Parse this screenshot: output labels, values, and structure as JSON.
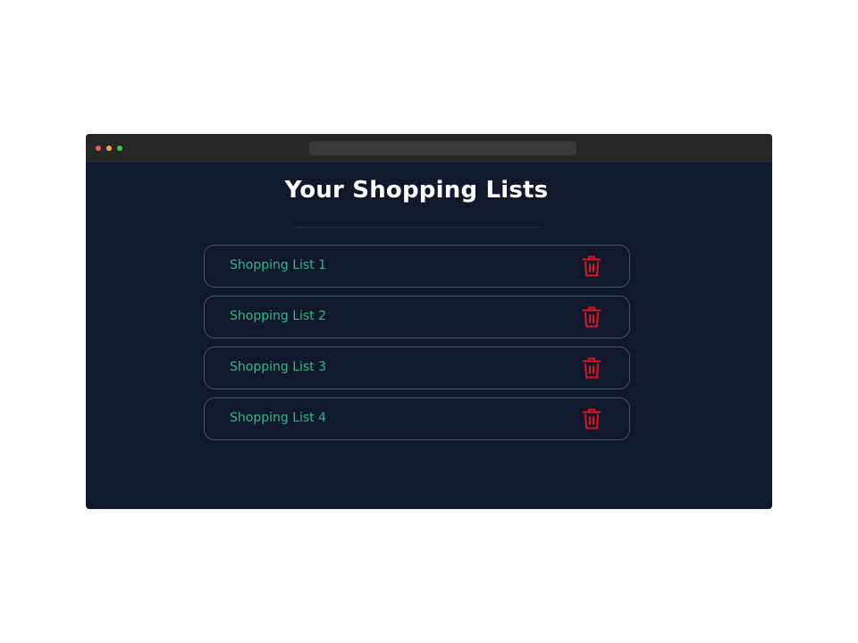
{
  "page": {
    "title": "Your Shopping Lists"
  },
  "lists": [
    {
      "label": "Shopping List 1"
    },
    {
      "label": "Shopping List 2"
    },
    {
      "label": "Shopping List 3"
    },
    {
      "label": "Shopping List 4"
    }
  ],
  "icons": {
    "delete": "trash-icon"
  },
  "colors": {
    "background": "#10192b",
    "title": "#ffffff",
    "list_label": "#2fb98a",
    "delete_icon": "#e2121f",
    "item_border": "#4a5264"
  }
}
